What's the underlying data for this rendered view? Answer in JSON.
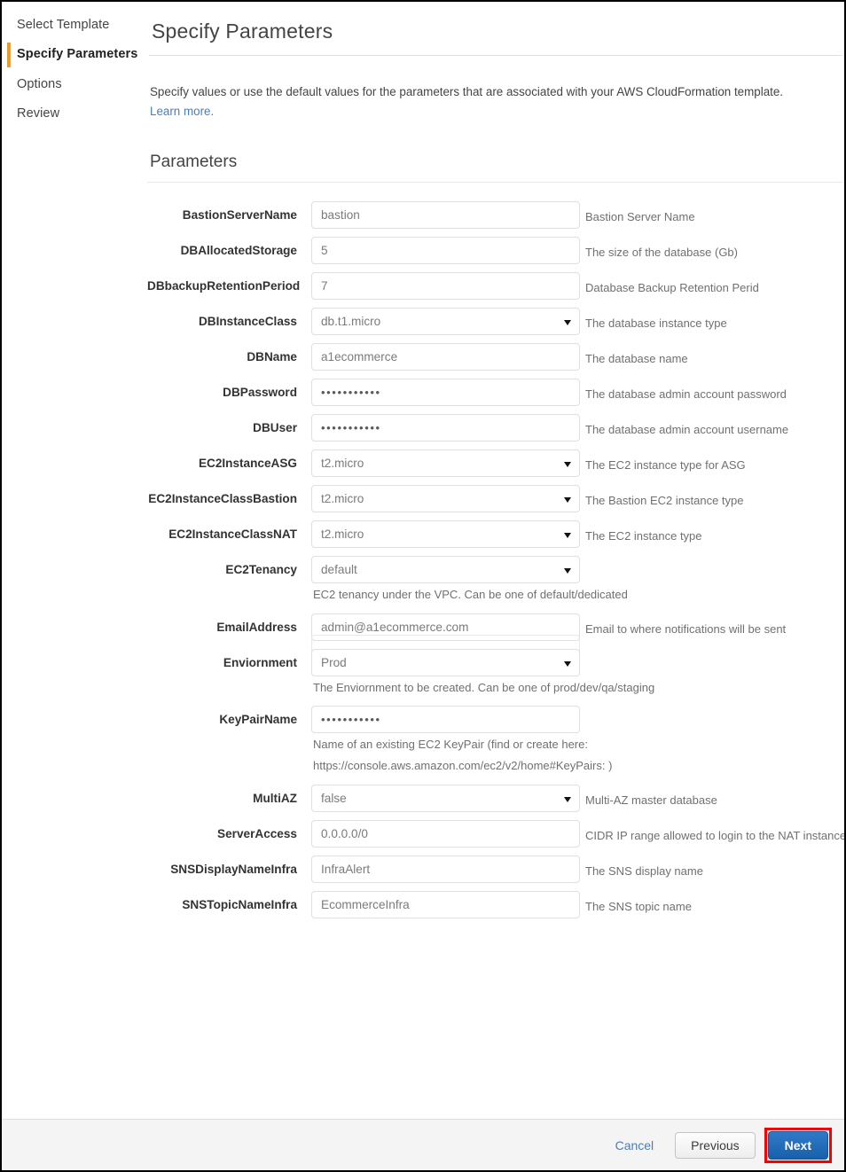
{
  "sidebar": {
    "items": [
      {
        "label": "Select Template",
        "active": false
      },
      {
        "label": "Specify Parameters",
        "active": true
      },
      {
        "label": "Options",
        "active": false
      },
      {
        "label": "Review",
        "active": false
      }
    ]
  },
  "header": {
    "title": "Specify Parameters"
  },
  "intro": {
    "text": "Specify values or use the default values for the parameters that are associated with your AWS CloudFormation template.",
    "link": "Learn more."
  },
  "section": {
    "title": "Parameters"
  },
  "parameters": [
    {
      "name": "BastionServerName",
      "type": "text",
      "value": "bastion",
      "description": "Bastion Server Name"
    },
    {
      "name": "DBAllocatedStorage",
      "type": "text",
      "value": "5",
      "description": "The size of the database (Gb)"
    },
    {
      "name": "DBbackupRetentionPeriod",
      "type": "text",
      "value": "7",
      "description": "Database Backup Retention Perid"
    },
    {
      "name": "DBInstanceClass",
      "type": "select",
      "value": "db.t1.micro",
      "description": "The database instance type"
    },
    {
      "name": "DBName",
      "type": "text",
      "value": "a1ecommerce",
      "description": "The database name"
    },
    {
      "name": "DBPassword",
      "type": "password",
      "value": "•••••••••••",
      "description": "The database admin account password"
    },
    {
      "name": "DBUser",
      "type": "password",
      "value": "•••••••••••",
      "description": "The database admin account username"
    },
    {
      "name": "EC2InstanceASG",
      "type": "select",
      "value": "t2.micro",
      "description": "The EC2 instance type for ASG"
    },
    {
      "name": "EC2InstanceClassBastion",
      "type": "select",
      "value": "t2.micro",
      "description": "The Bastion EC2 instance type"
    },
    {
      "name": "EC2InstanceClassNAT",
      "type": "select",
      "value": "t2.micro",
      "description": "The EC2 instance type"
    },
    {
      "name": "EC2Tenancy",
      "type": "select",
      "value": "default",
      "description": "",
      "help": [
        "EC2 tenancy under the VPC. Can be one of default/dedicated"
      ]
    },
    {
      "name": "EmailAddress",
      "type": "text",
      "value": "admin@a1ecommerce.com",
      "description": "Email to where notifications will be sent"
    },
    {
      "name": "Enviornment",
      "type": "select",
      "value": "Prod",
      "description": "",
      "ghost": true,
      "help": [
        "The Enviornment to be created. Can be one of prod/dev/qa/staging"
      ]
    },
    {
      "name": "KeyPairName",
      "type": "password",
      "value": "•••••••••••",
      "description": "",
      "help": [
        "Name of an existing EC2 KeyPair (find or create here:",
        "https://console.aws.amazon.com/ec2/v2/home#KeyPairs: )"
      ]
    },
    {
      "name": "MultiAZ",
      "type": "select",
      "value": "false",
      "description": "Multi-AZ master database"
    },
    {
      "name": "ServerAccess",
      "type": "text",
      "value": "0.0.0.0/0",
      "description": "CIDR IP range allowed to login to the NAT instance"
    },
    {
      "name": "SNSDisplayNameInfra",
      "type": "text",
      "value": "InfraAlert",
      "description": "The SNS display name"
    },
    {
      "name": "SNSTopicNameInfra",
      "type": "text",
      "value": "EcommerceInfra",
      "description": "The SNS topic name"
    }
  ],
  "footer": {
    "cancel_label": "Cancel",
    "previous_label": "Previous",
    "next_label": "Next"
  },
  "colors": {
    "accent_orange": "#ec9c22",
    "link_blue": "#4a7ebb",
    "next_button_blue": "#1860ab",
    "highlight_red": "#f40000"
  }
}
